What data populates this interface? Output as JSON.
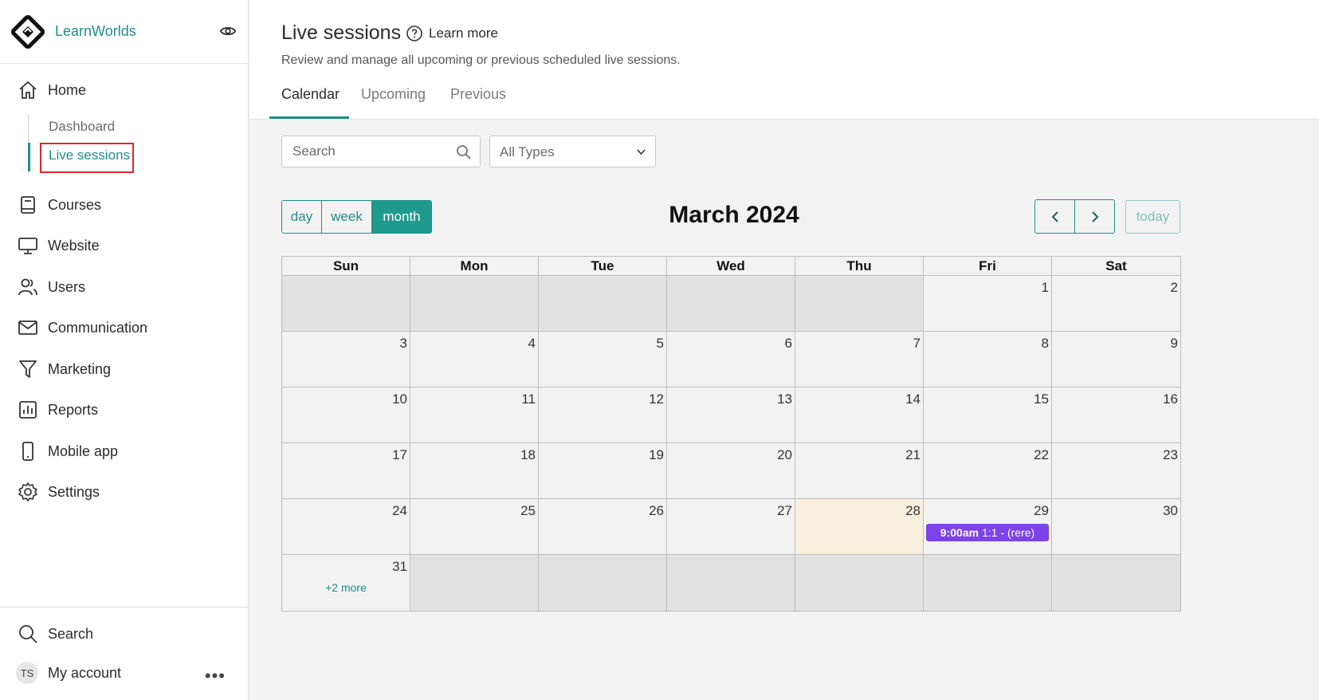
{
  "brand": {
    "name": "LearnWorlds"
  },
  "sidebar": {
    "home_label": "Home",
    "sub_items": [
      "Dashboard",
      "Live sessions"
    ],
    "items": [
      "Courses",
      "Website",
      "Users",
      "Communication",
      "Marketing",
      "Reports",
      "Mobile app",
      "Settings"
    ],
    "search_label": "Search",
    "account_label": "My account",
    "avatar_initials": "TS",
    "more_glyph": "•••"
  },
  "header": {
    "title": "Live sessions",
    "learn_more": "Learn more",
    "subtitle": "Review and manage all upcoming or previous scheduled live sessions.",
    "tabs": [
      "Calendar",
      "Upcoming",
      "Previous"
    ]
  },
  "filters": {
    "search_placeholder": "Search",
    "type_value": "All Types"
  },
  "calendar": {
    "views": [
      "day",
      "week",
      "month"
    ],
    "active_view": "month",
    "title": "March 2024",
    "today_label": "today",
    "weekdays": [
      "Sun",
      "Mon",
      "Tue",
      "Wed",
      "Thu",
      "Fri",
      "Sat"
    ],
    "first_weekday_index": 5,
    "days_in_month": 31,
    "today": 28,
    "events": [
      {
        "day": 29,
        "time": "9:00am",
        "title": "1:1 - (rere)"
      }
    ],
    "more_links": [
      {
        "day": 31,
        "label": "+2 more"
      }
    ]
  },
  "colors": {
    "accent": "#1f8f84",
    "event": "#7c43e8",
    "today_bg": "#f7f0de",
    "highlight": "#e0262c"
  }
}
